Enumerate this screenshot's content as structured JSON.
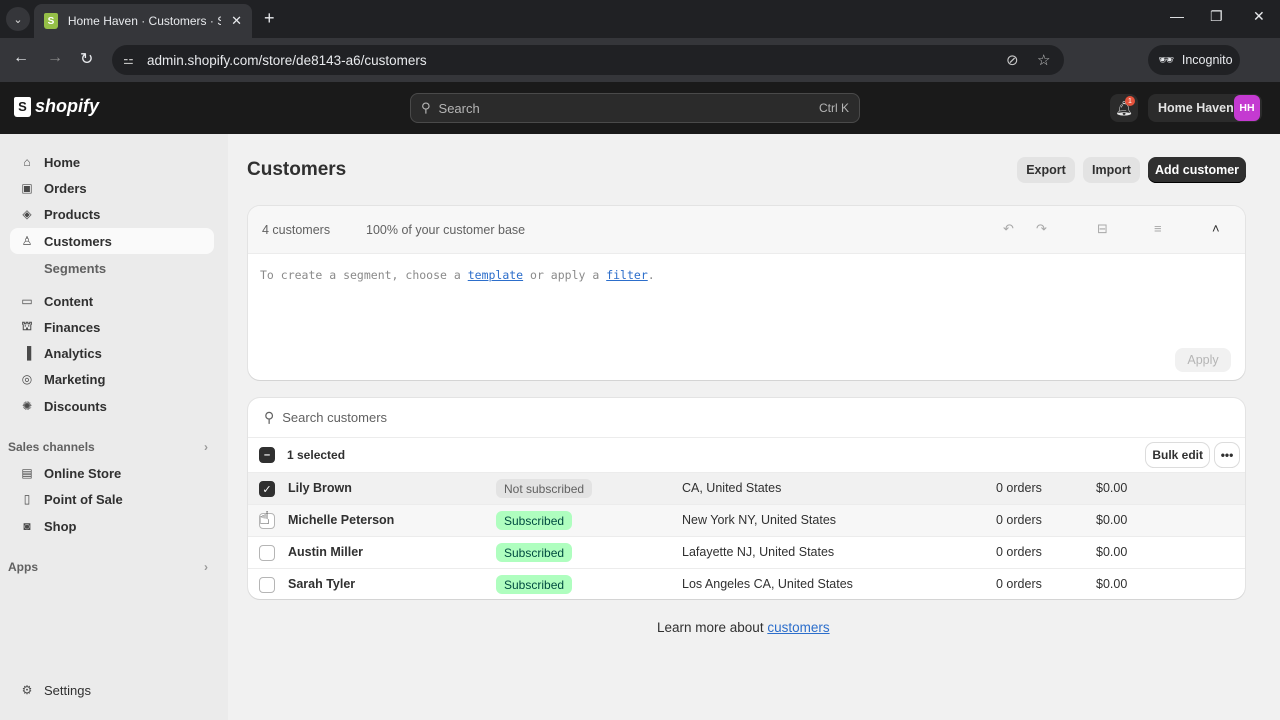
{
  "browser": {
    "tab_title": "Home Haven · Customers · Shopify",
    "tab_favicon": "shopify-bag-icon",
    "url": "admin.shopify.com/store/de8143-a6/customers",
    "profile_label": "Incognito",
    "window_controls": [
      "minimize",
      "restore",
      "close"
    ]
  },
  "topbar": {
    "logo_text": "shopify",
    "search_placeholder": "Search",
    "search_shortcut": "Ctrl K",
    "notification_count": "1",
    "store_name": "Home Haven",
    "avatar_initials": "HH",
    "avatar_color": "#c43ad1"
  },
  "sidebar": {
    "items": [
      {
        "label": "Home",
        "icon": "home-icon"
      },
      {
        "label": "Orders",
        "icon": "inbox-icon"
      },
      {
        "label": "Products",
        "icon": "tag-icon"
      },
      {
        "label": "Customers",
        "icon": "person-icon",
        "active": true
      },
      {
        "label": "Content",
        "icon": "image-icon"
      },
      {
        "label": "Finances",
        "icon": "bank-icon"
      },
      {
        "label": "Analytics",
        "icon": "bar-chart-icon"
      },
      {
        "label": "Marketing",
        "icon": "target-icon"
      },
      {
        "label": "Discounts",
        "icon": "discount-icon"
      }
    ],
    "sub_items": {
      "customers": [
        "Segments"
      ]
    },
    "sales_channels_label": "Sales channels",
    "sales_channels": [
      {
        "label": "Online Store",
        "icon": "store-icon"
      },
      {
        "label": "Point of Sale",
        "icon": "pos-icon"
      },
      {
        "label": "Shop",
        "icon": "shop-icon"
      }
    ],
    "apps_label": "Apps",
    "settings_label": "Settings"
  },
  "page": {
    "title": "Customers",
    "actions": {
      "export": "Export",
      "import": "Import",
      "add": "Add customer"
    }
  },
  "segment": {
    "count": "4 customers",
    "percent": "100% of your customer base",
    "editor_prefix": "To create a segment, choose a ",
    "template_link": "template",
    "editor_middle": " or apply a ",
    "filter_link": "filter",
    "editor_suffix": ".",
    "apply_label": "Apply"
  },
  "table": {
    "search_placeholder": "Search customers",
    "selected_label": "1 selected",
    "bulk_edit_label": "Bulk edit",
    "more_label": "•••",
    "rows": [
      {
        "name": "Lily Brown",
        "subscription": "Not subscribed",
        "subscribed": false,
        "location": "CA, United States",
        "orders": "0 orders",
        "spent": "$0.00",
        "checked": true
      },
      {
        "name": "Michelle Peterson",
        "subscription": "Subscribed",
        "subscribed": true,
        "location": "New York NY, United States",
        "orders": "0 orders",
        "spent": "$0.00",
        "checked": false
      },
      {
        "name": "Austin Miller",
        "subscription": "Subscribed",
        "subscribed": true,
        "location": "Lafayette NJ, United States",
        "orders": "0 orders",
        "spent": "$0.00",
        "checked": false
      },
      {
        "name": "Sarah Tyler",
        "subscription": "Subscribed",
        "subscribed": true,
        "location": "Los Angeles CA, United States",
        "orders": "0 orders",
        "spent": "$0.00",
        "checked": false
      }
    ]
  },
  "footer": {
    "learn_prefix": "Learn more about ",
    "learn_link": "customers"
  }
}
